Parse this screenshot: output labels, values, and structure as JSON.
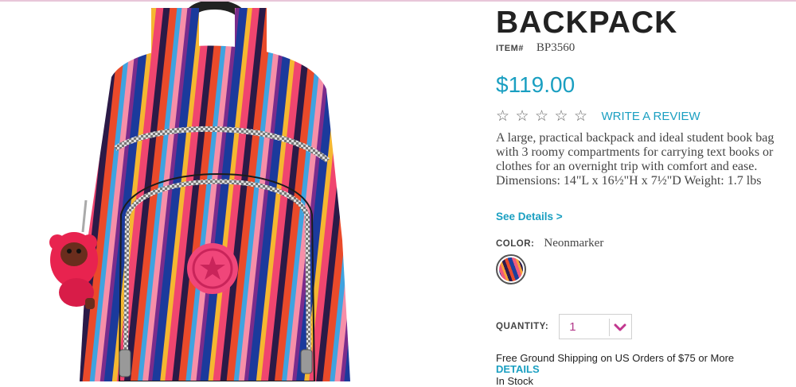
{
  "product": {
    "title": "BACKPACK",
    "item_label": "ITEM#",
    "item_number": "BP3560",
    "price": "$119.00",
    "rating": 0,
    "rating_max": 5,
    "rating_icon": "star-outline-icon",
    "write_review_label": "WRITE A REVIEW",
    "description": "A large, practical backpack and ideal student book bag with 3 roomy compartments for carrying text books or clothes for an overnight trip with comfort and ease. Dimensions: 14\"L x 16½\"H x 7½\"D Weight: 1.7 lbs",
    "see_details_label": "See Details >"
  },
  "color": {
    "label": "COLOR:",
    "selected": "Neonmarker"
  },
  "quantity": {
    "label": "QUANTITY:",
    "value": "1",
    "icon": "chevron-down-icon"
  },
  "shipping": {
    "text": "Free Ground Shipping on US Orders of $75 or More",
    "details_label": "DETAILS"
  },
  "stock": "In Stock",
  "colors": {
    "accent": "#1a9fc1",
    "quantity_accent": "#c2378f",
    "text": "#333333"
  }
}
